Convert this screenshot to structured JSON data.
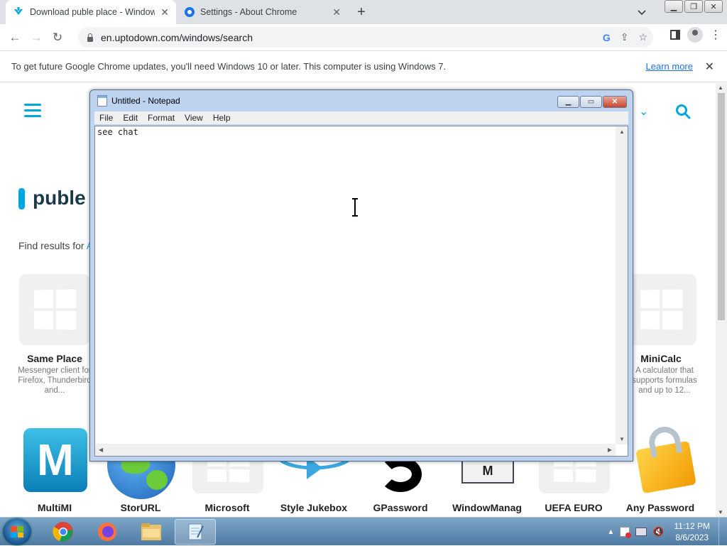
{
  "browser": {
    "tabs": [
      {
        "title": "Download puble place - Window",
        "active": true
      },
      {
        "title": "Settings - About Chrome",
        "active": false
      }
    ],
    "url": "en.uptodown.com/windows/search",
    "infobar": {
      "message": "To get future Google Chrome updates, you'll need Windows 10 or later. This computer is using Windows 7.",
      "link": "Learn more"
    }
  },
  "page": {
    "heading": "puble",
    "find_results_prefix": "Find results for ",
    "find_results_hl": "A",
    "cards_top": [
      {
        "title": "Same Place",
        "desc": "Messenger client for Firefox, Thunderbird and..."
      },
      {
        "title": "MiniCalc",
        "desc": "A calculator that supports formulas and up to 12..."
      }
    ],
    "cards_bottom": [
      "MultiMI",
      "StorURL",
      "Microsoft",
      "Style Jukebox",
      "GPassword",
      "WindowManag",
      "UEFA EURO",
      "Any Password"
    ]
  },
  "notepad": {
    "title": "Untitled - Notepad",
    "menu": [
      "File",
      "Edit",
      "Format",
      "View",
      "Help"
    ],
    "content": "see chat"
  },
  "taskbar": {
    "time": "11:12 PM",
    "date": "8/6/2023"
  },
  "colors": {
    "accent": "#00a6df",
    "heading": "#1a3a4a"
  }
}
